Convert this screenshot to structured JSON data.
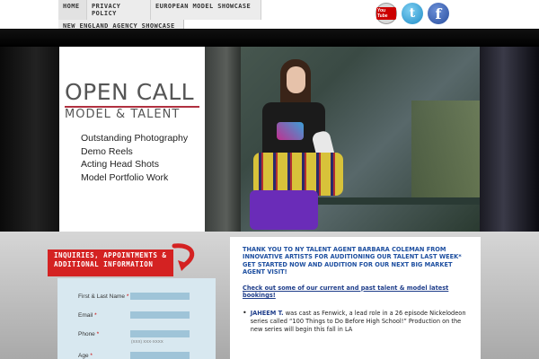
{
  "nav": {
    "items": [
      "HOME",
      "PRIVACY POLICY",
      "EUROPEAN MODEL SHOWCASE"
    ],
    "sub_item": "NEW ENGLAND AGENCY SHOWCASE"
  },
  "social": {
    "youtube": "You Tube",
    "twitter_icon": "t",
    "facebook_icon": "f"
  },
  "hero": {
    "brand_line1": "OPEN CALL",
    "brand_line2": "MODEL & TALENT",
    "services": [
      "Outstanding Photography",
      "Demo Reels",
      "Acting Head Shots",
      "Model Portfolio Work"
    ],
    "slide_count": 5,
    "active_slide": 1
  },
  "form": {
    "tab_title": "INQUIRIES, APPOINTMENTS & ADDITIONAL INFORMATION",
    "fields": [
      {
        "label": "First & Last Name",
        "required": "*"
      },
      {
        "label": "Email",
        "required": "*"
      },
      {
        "label": "Phone",
        "required": "*"
      },
      {
        "label": "Age",
        "required": "*"
      }
    ],
    "phone_hint": "(XXX) XXX-XXXX"
  },
  "content": {
    "intro": "THANK YOU TO NY TALENT AGENT BARBARA COLEMAN FROM INNOVATIVE ARTISTS FOR AUDITIONING OUR TALENT LAST WEEK* GET STARTED NOW AND AUDITION FOR OUR NEXT BIG MARKET AGENT VISIT!",
    "link": "Check out some of our current and past talent & model latest bookings!",
    "bullets": [
      {
        "name": "JAHEEM T.",
        "text": " was cast as Fenwick, a lead role in a 26 episode Nickelodeon series called “100 Things to Do Before High School!” Production on the new series will begin this fall in LA"
      }
    ]
  },
  "colors": {
    "accent_red": "#d42222",
    "link_blue": "#1e3d8a",
    "form_bg": "#d8e8f0",
    "input_bg": "#9fc4d8"
  }
}
